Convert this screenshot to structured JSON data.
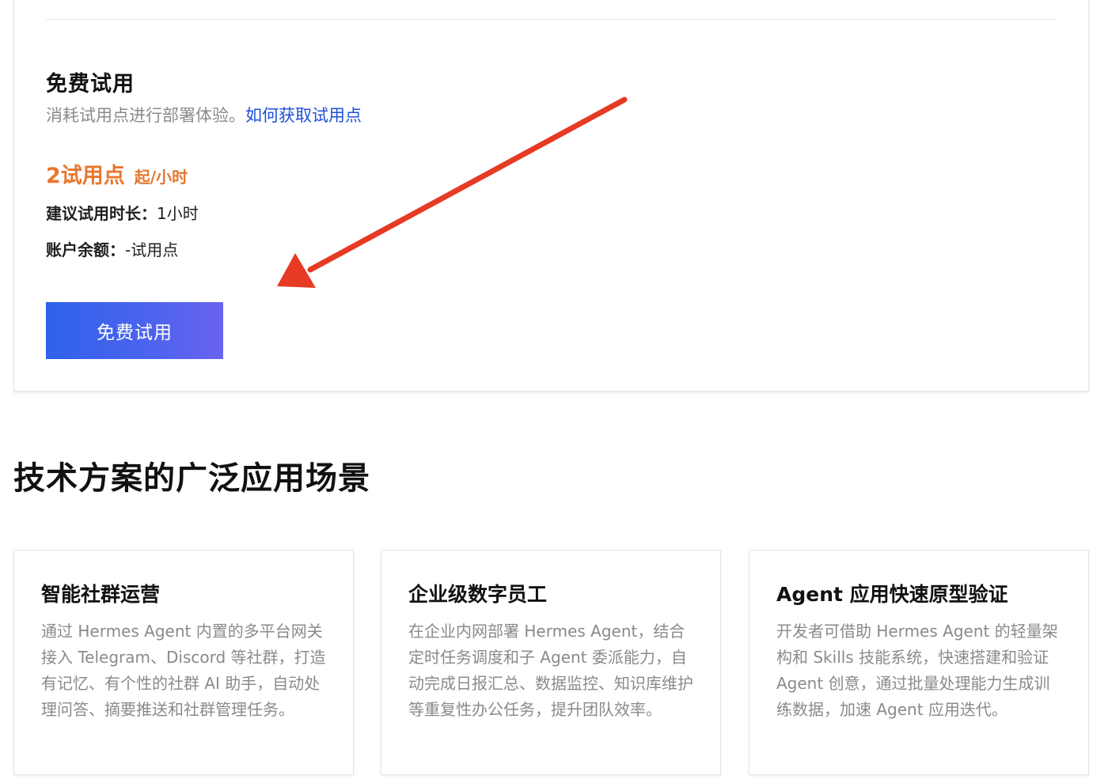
{
  "trial": {
    "title": "免费试用",
    "description": "消耗试用点进行部署体验。",
    "description_link": "如何获取试用点",
    "price_main": "2试用点",
    "price_unit": "起/小时",
    "duration_label": "建议试用时长：",
    "duration_value": "1小时",
    "balance_label": "账户余额：",
    "balance_value": "-试用点",
    "button_label": "免费试用"
  },
  "scenarios": {
    "title": "技术方案的广泛应用场景",
    "cards": [
      {
        "title": "智能社群运营",
        "body": "通过 Hermes Agent 内置的多平台网关接入 Telegram、Discord 等社群，打造有记忆、有个性的社群 AI 助手，自动处理问答、摘要推送和社群管理任务。"
      },
      {
        "title": "企业级数字员工",
        "body": "在企业内网部署 Hermes Agent，结合定时任务调度和子 Agent 委派能力，自动完成日报汇总、数据监控、知识库维护等重复性办公任务，提升团队效率。"
      },
      {
        "title": "Agent 应用快速原型验证",
        "body": "开发者可借助 Hermes Agent 的轻量架构和 Skills 技能系统，快速搭建和验证 Agent 创意，通过批量处理能力生成训练数据，加速 Agent 应用迭代。"
      }
    ]
  },
  "colors": {
    "accent_orange": "#e8772e",
    "link_blue": "#1e50d8",
    "button_gradient_start": "#2f62ea",
    "button_gradient_end": "#6a63ee",
    "annotation_arrow": "#e63a24"
  },
  "icons": {
    "annotation": "red-arrow-annotation"
  }
}
